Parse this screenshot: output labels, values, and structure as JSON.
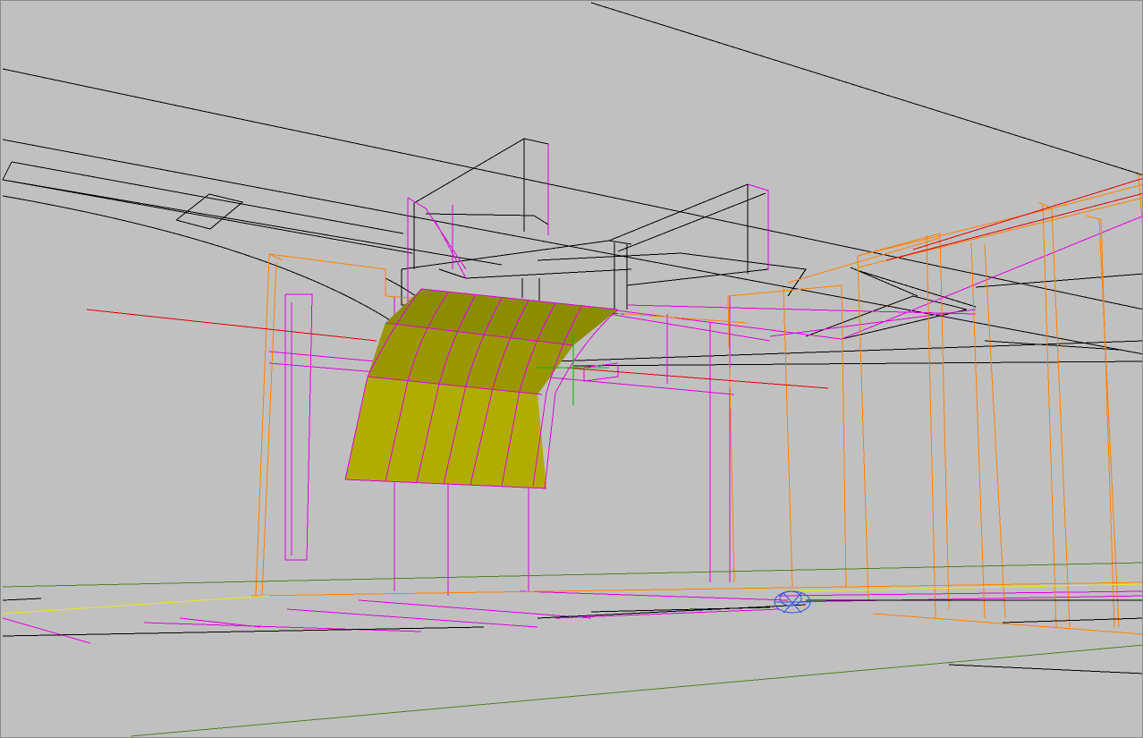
{
  "viewport": {
    "background": "#c0c0c0"
  },
  "colors": {
    "wire_black": "#000000",
    "wire_magenta": "#e000e0",
    "wire_orange": "#ff8000",
    "wire_red": "#e00000",
    "wire_green": "#508020",
    "wire_yellow": "#e8e820",
    "wire_blue": "#3050e0",
    "cursor_green": "#00c000",
    "surface_top": "#8c8c00",
    "surface_front": "#b0ac00",
    "surface_edge": "#5a5a00"
  },
  "scene": {
    "objects": [
      "ceiling-beams",
      "roof-edge-lines",
      "hvac-ducts",
      "steel-frame",
      "orange-columns",
      "curved-yellow-panel",
      "floor-lines",
      "floor-marker",
      "cursor"
    ]
  }
}
